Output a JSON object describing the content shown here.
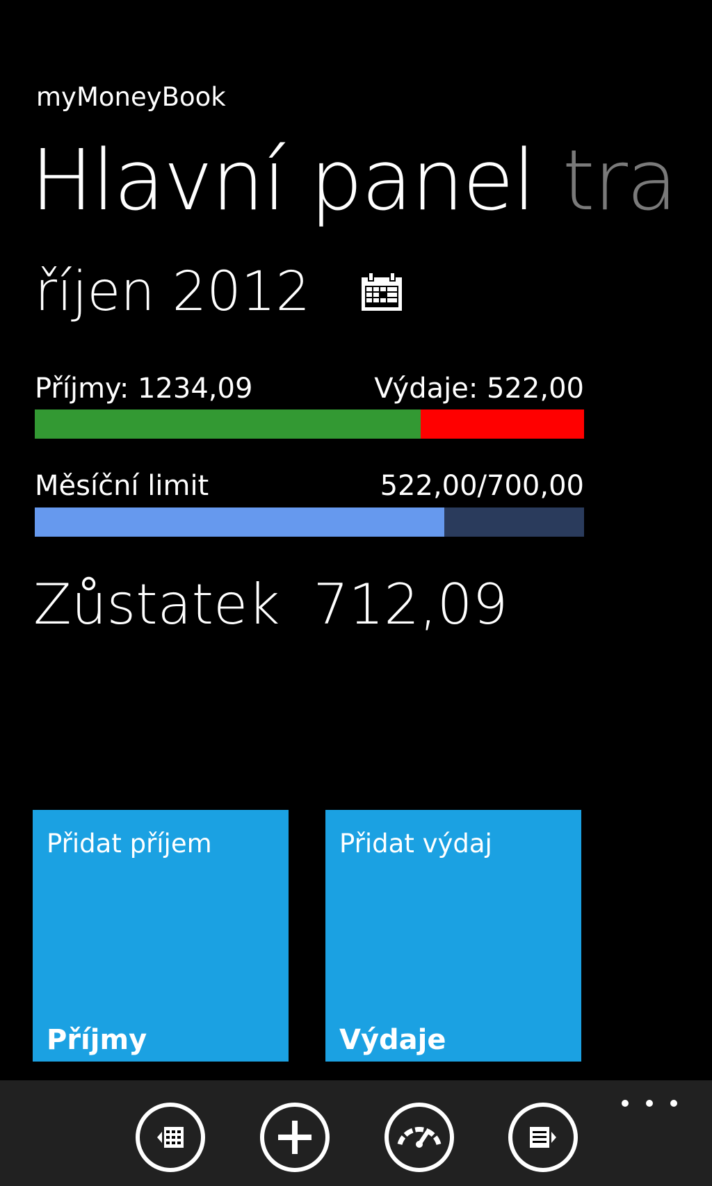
{
  "app": {
    "name": "myMoneyBook"
  },
  "pivot": {
    "active": "Hlavní panel",
    "next": "tra"
  },
  "month": {
    "label": "říjen 2012",
    "calendar_icon": "calendar-icon"
  },
  "income_expense": {
    "income_label": "Příjmy: 1234,09",
    "expense_label": "Výdaje: 522,00",
    "income_value": 1234.09,
    "expense_value": 522.0,
    "income_color": "#339933",
    "expense_color": "#ff0000"
  },
  "limit": {
    "label": "Měsíční limit",
    "value_label": "522,00/700,00",
    "spent": 522.0,
    "limit": 700.0,
    "fill_color": "#6699ee",
    "track_color": "#2a3b5c"
  },
  "balance": {
    "label": "Zůstatek",
    "value": "712,09"
  },
  "tiles": [
    {
      "top": "Přidat příjem",
      "bottom": "Příjmy",
      "color": "#1ba1e2"
    },
    {
      "top": "Přidat výdaj",
      "bottom": "Výdaje",
      "color": "#1ba1e2"
    }
  ],
  "app_bar": {
    "background": "#212121",
    "buttons": [
      {
        "icon": "previous-month-icon"
      },
      {
        "icon": "add-icon"
      },
      {
        "icon": "gauge-icon"
      },
      {
        "icon": "next-month-icon"
      }
    ],
    "more_icon": "more-dots-icon"
  }
}
